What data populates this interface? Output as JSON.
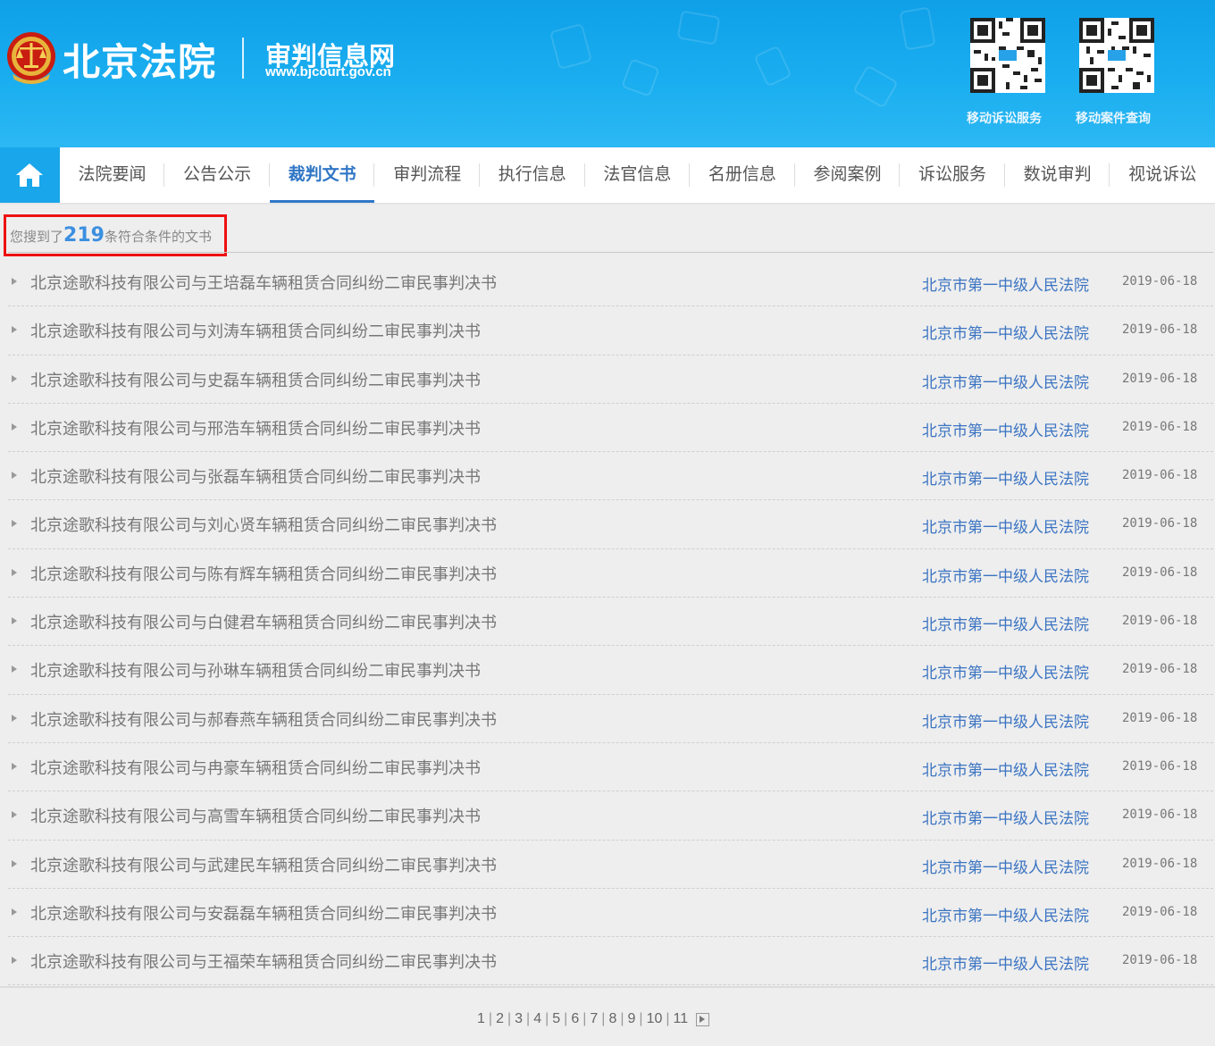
{
  "header": {
    "logo_main": "北京法院",
    "logo_sub": "审判信息网",
    "logo_url": "www.bjcourt.gov.cn",
    "qr_codes": [
      {
        "label": "移动诉讼服务"
      },
      {
        "label": "移动案件查询"
      }
    ]
  },
  "nav": {
    "home_icon": "home-icon",
    "items": [
      {
        "label": "法院要闻"
      },
      {
        "label": "公告公示"
      },
      {
        "label": "裁判文书",
        "active": true
      },
      {
        "label": "审判流程"
      },
      {
        "label": "执行信息"
      },
      {
        "label": "法官信息"
      },
      {
        "label": "名册信息"
      },
      {
        "label": "参阅案例"
      },
      {
        "label": "诉讼服务"
      },
      {
        "label": "数说审判"
      },
      {
        "label": "视说诉讼"
      }
    ]
  },
  "summary": {
    "prefix": "您搜到了",
    "count": "219",
    "suffix": "条符合条件的文书"
  },
  "documents": [
    {
      "title": "北京途歌科技有限公司与王培磊车辆租赁合同纠纷二审民事判决书",
      "court": "北京市第一中级人民法院",
      "date": "2019-06-18"
    },
    {
      "title": "北京途歌科技有限公司与刘涛车辆租赁合同纠纷二审民事判决书",
      "court": "北京市第一中级人民法院",
      "date": "2019-06-18"
    },
    {
      "title": "北京途歌科技有限公司与史磊车辆租赁合同纠纷二审民事判决书",
      "court": "北京市第一中级人民法院",
      "date": "2019-06-18"
    },
    {
      "title": "北京途歌科技有限公司与邢浩车辆租赁合同纠纷二审民事判决书",
      "court": "北京市第一中级人民法院",
      "date": "2019-06-18"
    },
    {
      "title": "北京途歌科技有限公司与张磊车辆租赁合同纠纷二审民事判决书",
      "court": "北京市第一中级人民法院",
      "date": "2019-06-18"
    },
    {
      "title": "北京途歌科技有限公司与刘心贤车辆租赁合同纠纷二审民事判决书",
      "court": "北京市第一中级人民法院",
      "date": "2019-06-18"
    },
    {
      "title": "北京途歌科技有限公司与陈有辉车辆租赁合同纠纷二审民事判决书",
      "court": "北京市第一中级人民法院",
      "date": "2019-06-18"
    },
    {
      "title": "北京途歌科技有限公司与白健君车辆租赁合同纠纷二审民事判决书",
      "court": "北京市第一中级人民法院",
      "date": "2019-06-18"
    },
    {
      "title": "北京途歌科技有限公司与孙琳车辆租赁合同纠纷二审民事判决书",
      "court": "北京市第一中级人民法院",
      "date": "2019-06-18"
    },
    {
      "title": "北京途歌科技有限公司与郝春燕车辆租赁合同纠纷二审民事判决书",
      "court": "北京市第一中级人民法院",
      "date": "2019-06-18"
    },
    {
      "title": "北京途歌科技有限公司与冉豪车辆租赁合同纠纷二审民事判决书",
      "court": "北京市第一中级人民法院",
      "date": "2019-06-18"
    },
    {
      "title": "北京途歌科技有限公司与高雪车辆租赁合同纠纷二审民事判决书",
      "court": "北京市第一中级人民法院",
      "date": "2019-06-18"
    },
    {
      "title": "北京途歌科技有限公司与武建民车辆租赁合同纠纷二审民事判决书",
      "court": "北京市第一中级人民法院",
      "date": "2019-06-18"
    },
    {
      "title": "北京途歌科技有限公司与安磊磊车辆租赁合同纠纷二审民事判决书",
      "court": "北京市第一中级人民法院",
      "date": "2019-06-18"
    },
    {
      "title": "北京途歌科技有限公司与王福荣车辆租赁合同纠纷二审民事判决书",
      "court": "北京市第一中级人民法院",
      "date": "2019-06-18"
    }
  ],
  "pagination": {
    "pages": [
      "1",
      "2",
      "3",
      "4",
      "5",
      "6",
      "7",
      "8",
      "9",
      "10",
      "11"
    ],
    "next_icon": "next-page-icon"
  }
}
